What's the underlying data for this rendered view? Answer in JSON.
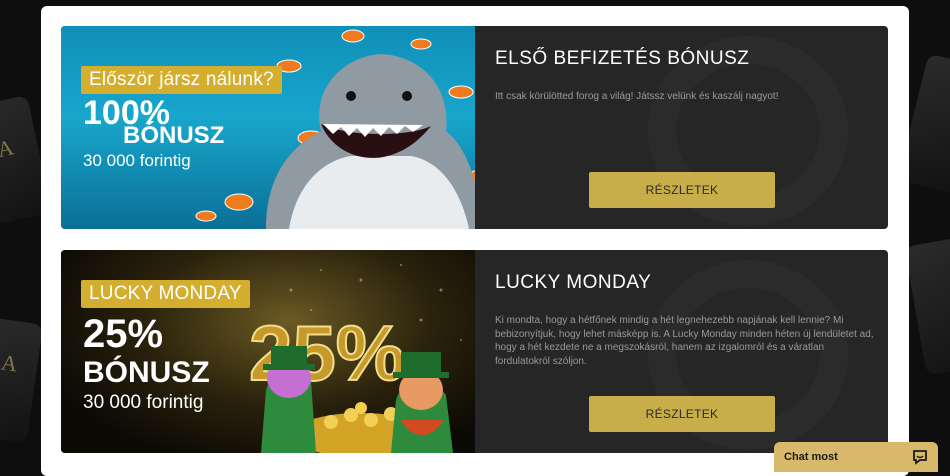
{
  "promos": [
    {
      "banner": {
        "pill": "Először jársz nálunk?",
        "percent": "100%",
        "bonus": "BÓNUSZ",
        "amount": "30 000 forintig"
      },
      "title": "ELSŐ BEFIZETÉS BÓNUSZ",
      "description": "Itt csak körülötted forog a világ! Játssz velünk és kaszálj nagyot!",
      "button": "RÉSZLETEK"
    },
    {
      "banner": {
        "pill": "LUCKY MONDAY",
        "percent": "25%",
        "bonus": "BÓNUSZ",
        "amount": "30 000 forintig",
        "art_text": "25%"
      },
      "title": "LUCKY MONDAY",
      "description": "Ki mondta, hogy a hétfőnek mindig a hét legnehezebb napjának kell lennie? Mi bebizonyítjuk, hogy lehet másképp is. A Lucky Monday minden héten új lendületet ad, hogy a hét kezdete ne a megszokásról, hanem az izgalomról és a váratlan fordulatokról szóljon.",
      "button": "RÉSZLETEK"
    }
  ],
  "chat": {
    "label": "Chat most",
    "icon": "chat-bubble-icon"
  },
  "background": {
    "card_letters": [
      "A",
      "A",
      "A"
    ]
  },
  "colors": {
    "accent": "#c7ae49",
    "panel": "#262626",
    "pill": "#d4ae2f"
  }
}
